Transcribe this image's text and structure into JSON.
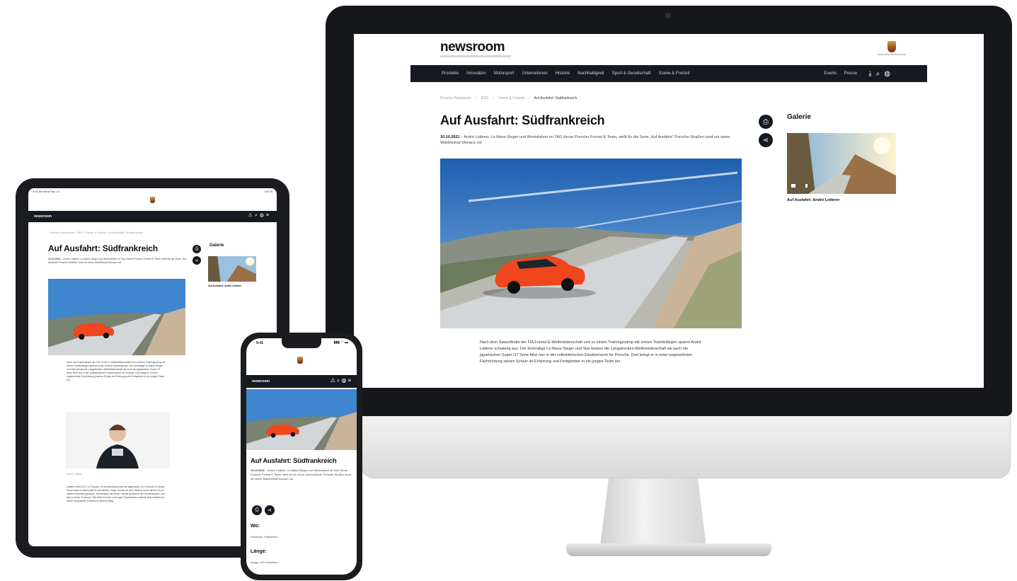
{
  "desktop": {
    "logo": "newsroom",
    "nav": {
      "items": [
        "Produkte",
        "Innovation",
        "Motorsport",
        "Unternehmen",
        "Historie",
        "Nachhaltigkeit",
        "Sport & Gesellschaft",
        "Szene & Freizeit"
      ],
      "right_items": [
        "Events",
        "Presse"
      ],
      "icons": [
        "download-icon",
        "search-icon",
        "globe-icon"
      ]
    },
    "breadcrumb": [
      "Porsche Newsroom",
      "2021",
      "Szene & Freizeit",
      "Auf Ausfahrt: Südfrankreich"
    ],
    "article": {
      "title": "Auf Ausfahrt: Südfrankreich",
      "date": "10.10.2021",
      "lead": "André Lotterer, Le-Mans-Sieger und Werksfahrer im TAG Heuer Porsche Formel E Team, stellt für die Serie „Auf Ausfahrt“ Porsche-Straßen rund um seine Wahlheimat Monaco vor.",
      "body": "Nach dem Saisonfinale der FIA Formel E-Weltmeisterschaft und zu einem Trainingscamp mit seinen Teamkollegen spannt André Lotterer schwierig aus. Der dreimalige Le-Mans-Sieger und Star bewies die Langstrecken-Weltmeisterschaft als auch die japanischen Super GT Serie fährt nun in der vollelektrischen Einsitzerserie für Porsche. Dort bringt er in einer ungewohnten Fachrichtung seinen Schatz an Erfahrung und Fertigkeiten in ein junges Team ein."
    },
    "share_buttons": [
      "print-icon",
      "share-icon"
    ],
    "gallery": {
      "title": "Galerie",
      "caption": "Auf Ausfahrt: André Lotterer"
    }
  },
  "tablet": {
    "status_time": "9:41 AM  Wed Sep 14",
    "status_battery": "100 %",
    "nav_logo": "newsroom",
    "nav_icons": "⚠⌕◍≡",
    "breadcrumb": "Porsche Newsroom  ›  2021  ›  Szene & Freizeit  ›  Auf Ausfahrt: Südfrankreich",
    "title": "Auf Ausfahrt: Südfrankreich",
    "date": "10.10.2021",
    "lead": "André Lotterer, Le-Mans-Sieger und Werksfahrer im TAG Heuer Porsche Formel E Team, stellt für die Serie „Auf Ausfahrt“ Porsche-Straßen rund um seine Wahlheimat Monaco vor.",
    "body": "Nach dem Saisonfinale der FIA Formel E-Weltmeisterschaft und zu einem Trainingscamp mit seinen Teamkollegen spannt André Lotterer schwierig aus. Der dreimalige Le-Mans-Sieger und Star bewies die Langstrecken-Weltmeisterschaft als auch die japanischen Super GT Serie fährt nun in der vollelektrischen Einsitzerserie für Porsche. Dort bringt er in einer ungewohnten Fachrichtung seinen Schatz an Erfahrung und Fertigkeiten in ein junges Team ein.",
    "photo_credit": "André Lotterer",
    "body2": "Lotterer zieht 2017 zu Porsche. Er lebt jahrelang über die legendären 24 h Rennen Le Mans. Durch seine Leidenschaft für die kleinen Dinge und die Art des Fahrens hat er diesen Ort zu seinem Wohnsitz gemacht. Gemeinsam mit seiner Familie genießt er die Küstenstraßen und das Licht der Provence. Die vielen Kurven und engen Passstraßen machen jede Ausfahrt zu einem besonderen Erlebnis in seinem Alltag.",
    "gallery_title": "Galerie",
    "gallery_caption": "Auf Ausfahrt: André Lotterer"
  },
  "phone": {
    "status_time": "9:41",
    "status_icons": "▮▮▮ ◠ ▬",
    "nav_logo": "newsroom",
    "nav_icons": "⚠⌕◍≡",
    "title": "Auf Ausfahrt: Südfrankreich",
    "date": "10.10.2021",
    "lead": "André Lotterer, Le-Mans-Sieger und Werksfahrer im TAG Heuer Porsche Formel E Team, stellt für die Serie „Auf Ausfahrt“ Porsche-Straßen rund um seine Wahlheimat Monaco vor.",
    "where_label": "Wo:",
    "where_value": "Provence, Frankreich",
    "length_label": "Länge:",
    "length_value": "Länge: 120 Kilometer"
  },
  "colors": {
    "nav_bg": "#141a1f",
    "car": "#f0461e",
    "sky": "#2a78c8"
  }
}
